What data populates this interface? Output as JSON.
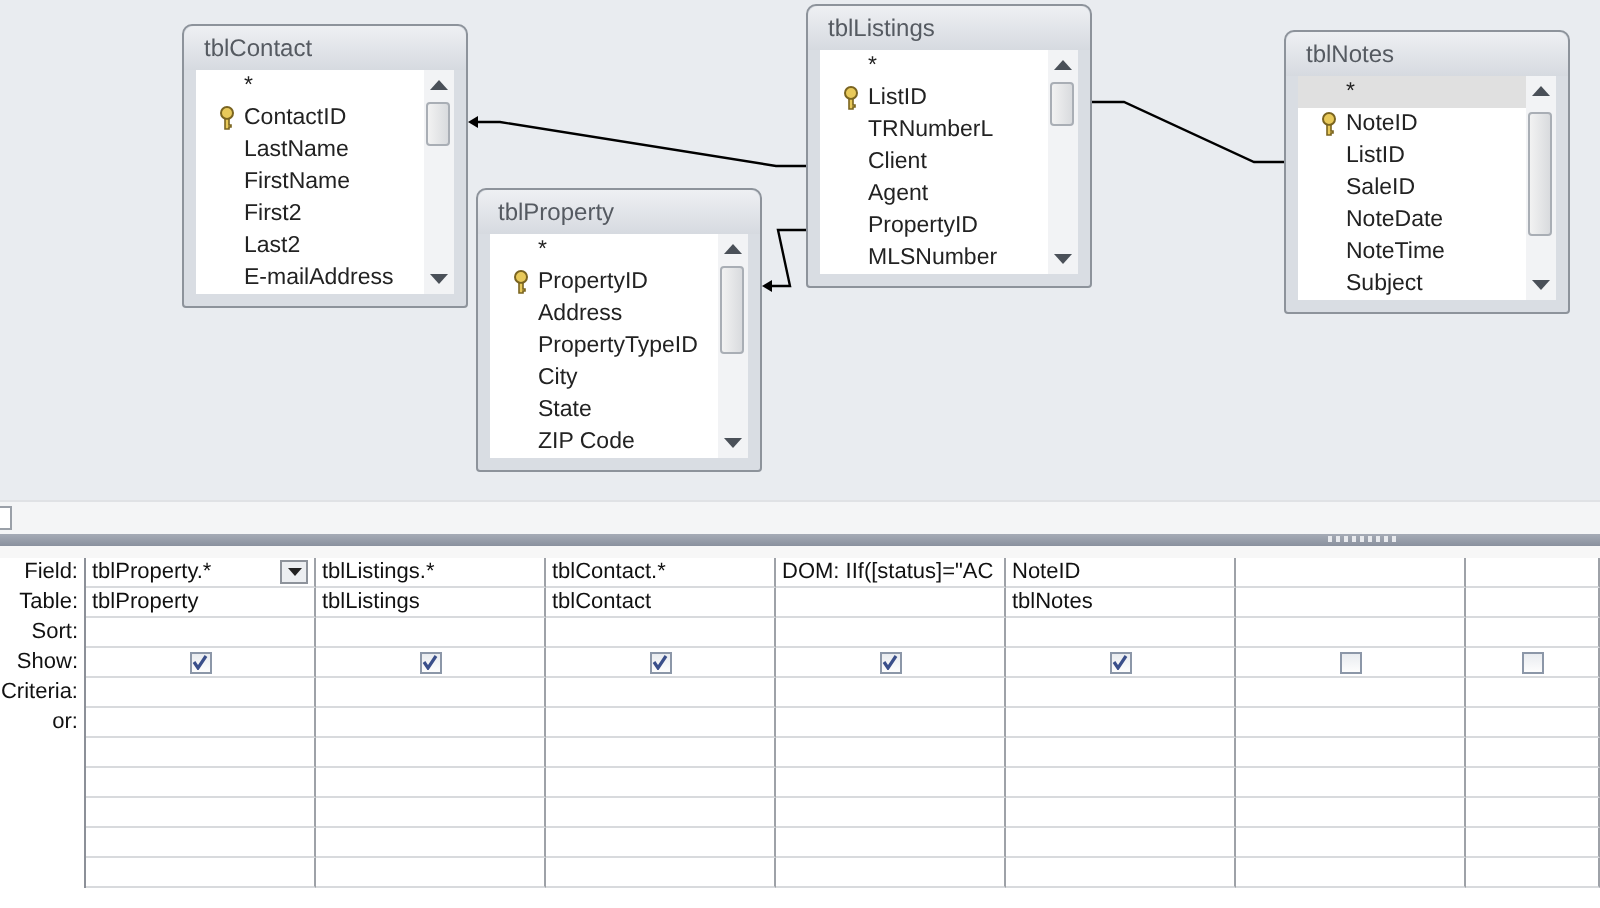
{
  "tables": [
    {
      "title": "tblContact",
      "fields": [
        {
          "name": "*",
          "key": false,
          "selected": false
        },
        {
          "name": "ContactID",
          "key": true,
          "selected": false
        },
        {
          "name": "LastName",
          "key": false,
          "selected": false
        },
        {
          "name": "FirstName",
          "key": false,
          "selected": false
        },
        {
          "name": "First2",
          "key": false,
          "selected": false
        },
        {
          "name": "Last2",
          "key": false,
          "selected": false
        },
        {
          "name": "E-mailAddress",
          "key": false,
          "selected": false
        }
      ]
    },
    {
      "title": "tblListings",
      "fields": [
        {
          "name": "*",
          "key": false,
          "selected": false
        },
        {
          "name": "ListID",
          "key": true,
          "selected": false
        },
        {
          "name": "TRNumberL",
          "key": false,
          "selected": false
        },
        {
          "name": "Client",
          "key": false,
          "selected": false
        },
        {
          "name": "Agent",
          "key": false,
          "selected": false
        },
        {
          "name": "PropertyID",
          "key": false,
          "selected": false
        },
        {
          "name": "MLSNumber",
          "key": false,
          "selected": false
        }
      ]
    },
    {
      "title": "tblProperty",
      "fields": [
        {
          "name": "*",
          "key": false,
          "selected": false
        },
        {
          "name": "PropertyID",
          "key": true,
          "selected": false
        },
        {
          "name": "Address",
          "key": false,
          "selected": false
        },
        {
          "name": "PropertyTypeID",
          "key": false,
          "selected": false
        },
        {
          "name": "City",
          "key": false,
          "selected": false
        },
        {
          "name": "State",
          "key": false,
          "selected": false
        },
        {
          "name": "ZIP Code",
          "key": false,
          "selected": false
        }
      ]
    },
    {
      "title": "tblNotes",
      "fields": [
        {
          "name": "*",
          "key": false,
          "selected": true
        },
        {
          "name": "NoteID",
          "key": true,
          "selected": false
        },
        {
          "name": "ListID",
          "key": false,
          "selected": false
        },
        {
          "name": "SaleID",
          "key": false,
          "selected": false
        },
        {
          "name": "NoteDate",
          "key": false,
          "selected": false
        },
        {
          "name": "NoteTime",
          "key": false,
          "selected": false
        },
        {
          "name": "Subject",
          "key": false,
          "selected": false
        }
      ]
    }
  ],
  "grid": {
    "row_labels": [
      "Field:",
      "Table:",
      "Sort:",
      "Show:",
      "Criteria:",
      "or:"
    ],
    "columns": [
      {
        "field": "tblProperty.*",
        "table": "tblProperty",
        "show": true,
        "dropdown": true
      },
      {
        "field": "tblListings.*",
        "table": "tblListings",
        "show": true,
        "dropdown": false
      },
      {
        "field": "tblContact.*",
        "table": "tblContact",
        "show": true,
        "dropdown": false
      },
      {
        "field": "DOM: IIf([status]=\"AC",
        "show": true,
        "dropdown": false
      },
      {
        "field": "NoteID",
        "table": "tblNotes",
        "show": true,
        "dropdown": false
      },
      {
        "show": false,
        "dropdown": false
      },
      {
        "show": false,
        "dropdown": false
      }
    ]
  }
}
